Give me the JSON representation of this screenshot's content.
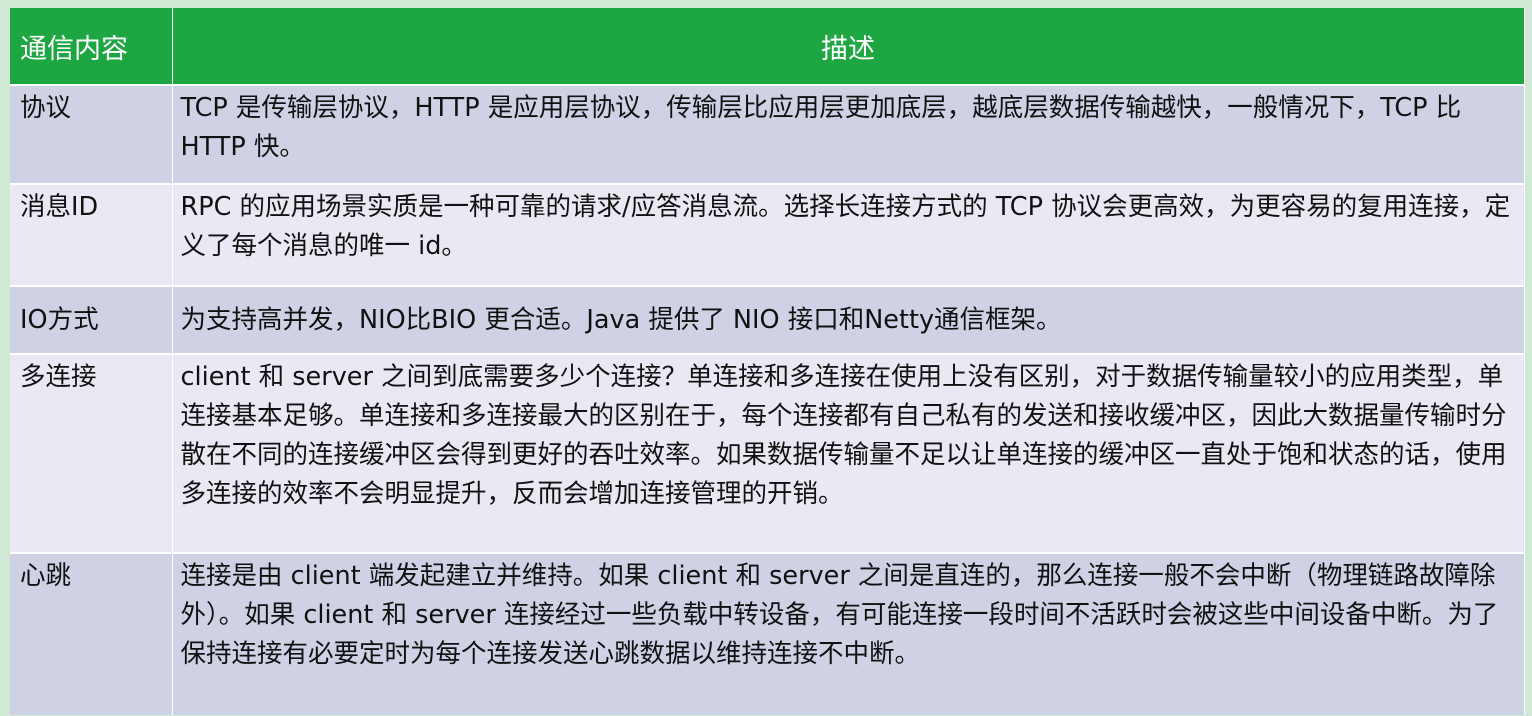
{
  "table": {
    "headers": [
      "通信内容",
      "描述"
    ],
    "rows": [
      {
        "key": "协议",
        "desc": "TCP 是传输层协议，HTTP 是应用层协议，传输层比应用层更加底层，越底层数据传输越快，一般情况下，TCP 比 HTTP 快。"
      },
      {
        "key": "消息ID",
        "desc": "RPC 的应用场景实质是一种可靠的请求/应答消息流。选择长连接方式的 TCP 协议会更高效，为更容易的复用连接，定义了每个消息的唯一 id。"
      },
      {
        "key": "IO方式",
        "desc": "为支持高并发，NIO比BIO 更合适。Java 提供了 NIO 接口和Netty通信框架。"
      },
      {
        "key": "多连接",
        "desc": "client 和 server 之间到底需要多少个连接？单连接和多连接在使用上没有区别，对于数据传输量较小的应用类型，单连接基本足够。单连接和多连接最大的区别在于，每个连接都有自己私有的发送和接收缓冲区，因此大数据量传输时分散在不同的连接缓冲区会得到更好的吞吐效率。如果数据传输量不足以让单连接的缓冲区一直处于饱和状态的话，使用多连接的效率不会明显提升，反而会增加连接管理的开销。"
      },
      {
        "key": "心跳",
        "desc": "连接是由 client 端发起建立并维持。如果 client 和 server 之间是直连的，那么连接一般不会中断（物理链路故障除外）。如果 client 和 server 连接经过一些负载中转设备，有可能连接一段时间不活跃时会被这些中间设备中断。为了保持连接有必要定时为每个连接发送心跳数据以维持连接不中断。"
      }
    ]
  },
  "colors": {
    "header_bg": "#1ea642",
    "row_odd_bg": "#cfd1e5",
    "row_even_bg": "#e8e9f2",
    "page_bg": "#cfe9d4"
  }
}
